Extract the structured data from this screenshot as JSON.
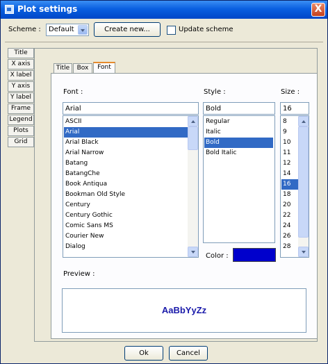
{
  "window": {
    "title": "Plot settings",
    "close_glyph": "X"
  },
  "scheme": {
    "label": "Scheme :",
    "selected": "Default",
    "create_label": "Create new...",
    "update_label": "Update scheme"
  },
  "sidebar_tabs": [
    "Title",
    "X axis",
    "X label",
    "Y axis",
    "Y label",
    "Frame",
    "Legend",
    "Plots",
    "Grid"
  ],
  "top_tabs": [
    "Title",
    "Box",
    "Font"
  ],
  "font_panel": {
    "font_label": "Font :",
    "style_label": "Style :",
    "size_label": "Size :",
    "font_value": "Arial",
    "style_value": "Bold",
    "size_value": "16",
    "fonts": [
      "ASCII",
      "Arial",
      "Arial Black",
      "Arial Narrow",
      "Batang",
      "BatangChe",
      "Book Antiqua",
      "Bookman Old Style",
      "Century",
      "Century Gothic",
      "Comic Sans MS",
      "Courier New",
      "Dialog"
    ],
    "selected_font": "Arial",
    "styles": [
      "Regular",
      "Italic",
      "Bold",
      "Bold Italic"
    ],
    "selected_style": "Bold",
    "sizes": [
      "8",
      "9",
      "10",
      "11",
      "12",
      "14",
      "16",
      "18",
      "20",
      "22",
      "24",
      "26",
      "28"
    ],
    "selected_size": "16",
    "color_label": "Color :",
    "color_value": "#0000cc",
    "preview_label": "Preview :",
    "preview_text": "AaBbYyZz",
    "preview_color": "#1a1aaa"
  },
  "buttons": {
    "ok": "Ok",
    "cancel": "Cancel"
  }
}
